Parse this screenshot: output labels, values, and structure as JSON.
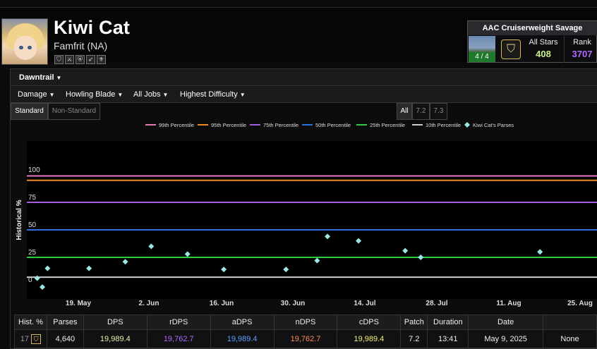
{
  "character": {
    "name": "Kiwi Cat",
    "server": "Famfrit (NA)"
  },
  "job_icons": [
    "shield-icon",
    "blade-icon",
    "crest-icon",
    "bow-icon",
    "fleur-icon"
  ],
  "zone": {
    "title": "AAC Cruiserweight Savage",
    "kills": "4 / 4",
    "all_stars_label": "All Stars",
    "all_stars_value": "408",
    "rank_label": "Rank",
    "rank_value": "3707"
  },
  "expansion": {
    "label": "Dawntrail"
  },
  "filters": {
    "metric": "Damage",
    "boss": "Howling Blade",
    "jobs": "All Jobs",
    "difficulty": "Highest Difficulty"
  },
  "tabs": {
    "standard": "Standard",
    "non_standard": "Non-Standard"
  },
  "patch_tabs": [
    "All",
    "7.2",
    "7.3"
  ],
  "colors": {
    "p99": "#e879b8",
    "p95": "#f08a1c",
    "p75": "#a35fe0",
    "p50": "#2d6fe0",
    "p25": "#2ecc40",
    "p10": "#cccccc",
    "parse": "#9ae6e6",
    "rdps": "#b36bff",
    "adps": "#5aa0ff",
    "ndps": "#ff8c5a",
    "cdps": "#f2f27a",
    "dps": "#e8f0a8"
  },
  "chart_data": {
    "type": "scatter",
    "ylabel": "Historical %",
    "ylim": [
      0,
      100
    ],
    "yticks": [
      0,
      25,
      50,
      75,
      100
    ],
    "xtick_labels": [
      "19. May",
      "2. Jun",
      "16. Jun",
      "30. Jun",
      "14. Jul",
      "28. Jul",
      "11. Aug",
      "25. Aug"
    ],
    "x_range": [
      "2025-05-10",
      "2025-08-28"
    ],
    "percentile_lines": [
      {
        "name": "99th Percentile",
        "value": 99
      },
      {
        "name": "95th Percentile",
        "value": 95
      },
      {
        "name": "75th Percentile",
        "value": 75
      },
      {
        "name": "50th Percentile",
        "value": 50
      },
      {
        "name": "25th Percentile",
        "value": 25
      },
      {
        "name": "10th Percentile",
        "value": 7
      }
    ],
    "series": [
      {
        "name": "Kiwi Cat's Parses",
        "points": [
          {
            "x": "2025-05-14",
            "y": 15
          },
          {
            "x": "2025-05-12",
            "y": 6
          },
          {
            "x": "2025-05-13",
            "y": -2
          },
          {
            "x": "2025-05-22",
            "y": 15
          },
          {
            "x": "2025-05-29",
            "y": 21
          },
          {
            "x": "2025-06-03",
            "y": 35
          },
          {
            "x": "2025-06-10",
            "y": 28
          },
          {
            "x": "2025-06-17",
            "y": 14
          },
          {
            "x": "2025-06-29",
            "y": 14
          },
          {
            "x": "2025-07-05",
            "y": 22
          },
          {
            "x": "2025-07-07",
            "y": 44
          },
          {
            "x": "2025-07-13",
            "y": 40
          },
          {
            "x": "2025-07-22",
            "y": 31
          },
          {
            "x": "2025-07-25",
            "y": 25
          },
          {
            "x": "2025-08-17",
            "y": 30
          }
        ]
      }
    ]
  },
  "table": {
    "headers": [
      "Hist. %",
      "Parses",
      "DPS",
      "rDPS",
      "aDPS",
      "nDPS",
      "cDPS",
      "Patch",
      "Duration",
      "Date"
    ],
    "row": {
      "hist": "17",
      "parses": "4,640",
      "dps": "19,989.4",
      "rdps": "19,762.7",
      "adps": "19,989.4",
      "ndps": "19,762.7",
      "cdps": "19,989.4",
      "patch": "7.2",
      "duration": "13:41",
      "date": "May 9, 2025",
      "extra": "None"
    }
  }
}
